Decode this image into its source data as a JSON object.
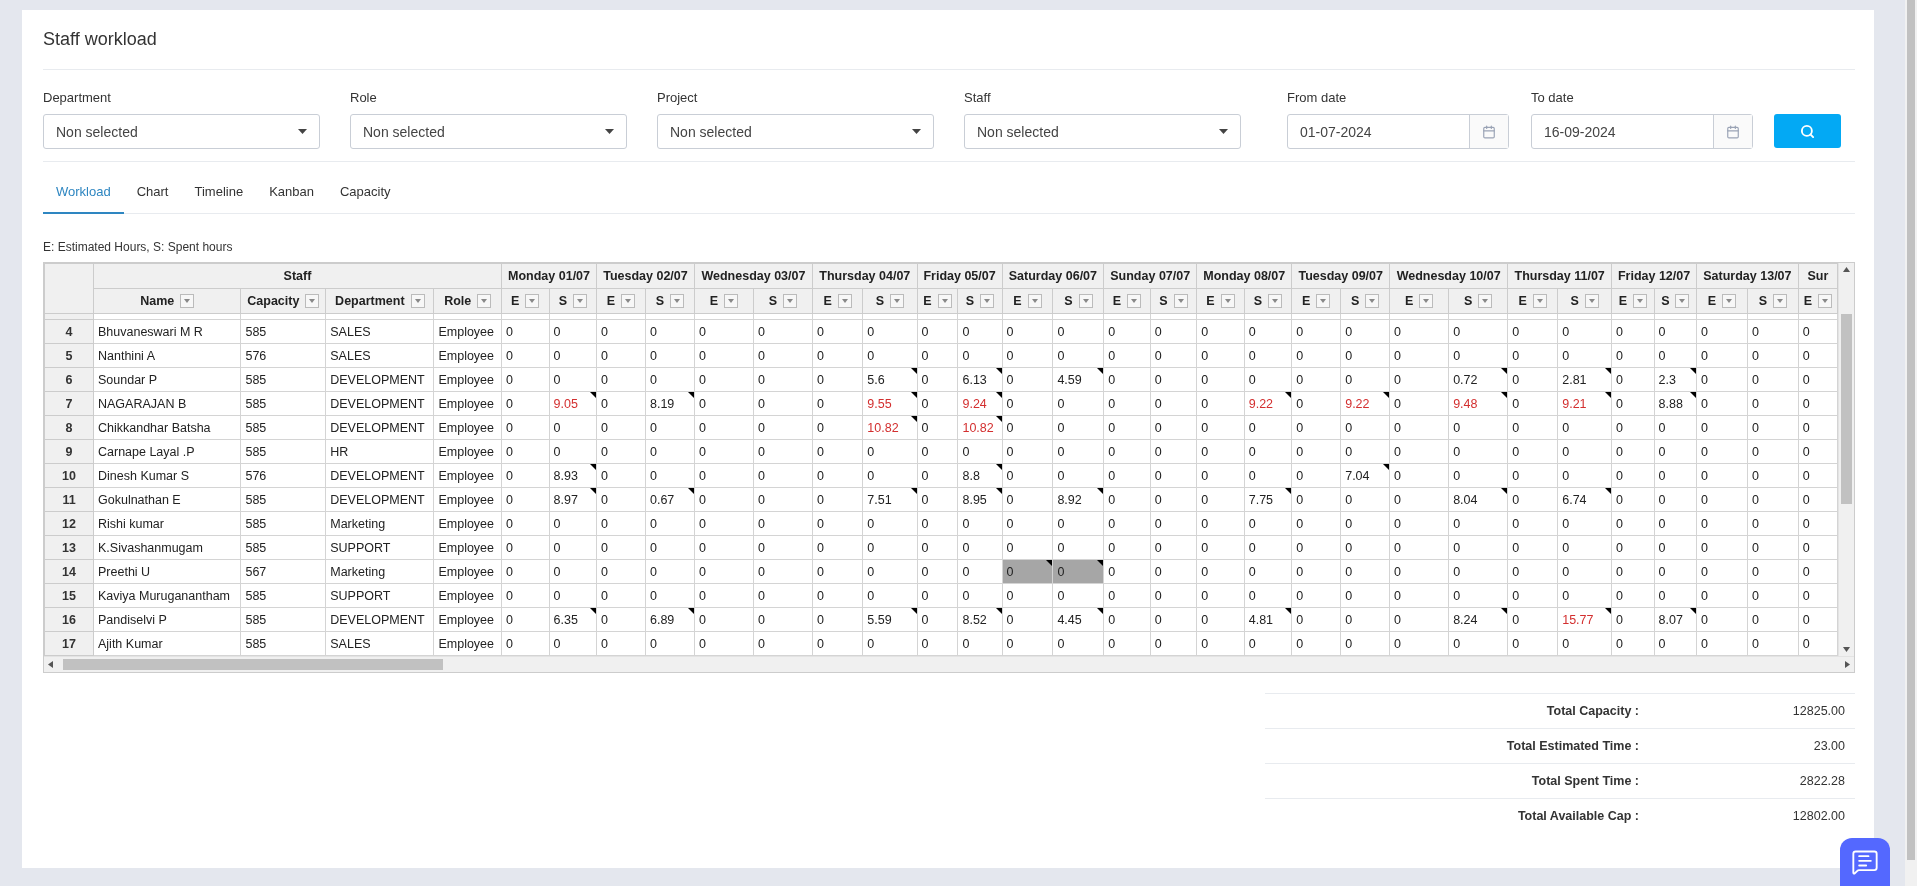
{
  "page": {
    "title": "Staff workload"
  },
  "filters": [
    {
      "kind": "select",
      "label": "Department",
      "value": "Non selected"
    },
    {
      "kind": "select",
      "label": "Role",
      "value": "Non selected"
    },
    {
      "kind": "select",
      "label": "Project",
      "value": "Non selected"
    },
    {
      "kind": "select",
      "label": "Staff",
      "value": "Non selected"
    },
    {
      "kind": "date",
      "label": "From date",
      "value": "01-07-2024"
    },
    {
      "kind": "date",
      "label": "To date",
      "value": "16-09-2024"
    }
  ],
  "tabs": [
    {
      "label": "Workload",
      "selected": true
    },
    {
      "label": "Chart",
      "selected": false
    },
    {
      "label": "Timeline",
      "selected": false
    },
    {
      "label": "Kanban",
      "selected": false
    },
    {
      "label": "Capacity",
      "selected": false
    }
  ],
  "legend": "E: Estimated Hours, S: Spent hours",
  "grid": {
    "group_label": "Staff",
    "staff_columns": [
      "Name",
      "Capacity",
      "Department",
      "Role"
    ],
    "days": [
      {
        "label": "Monday 01/07",
        "columns": [
          "E",
          "S"
        ]
      },
      {
        "label": "Tuesday 02/07",
        "columns": [
          "E",
          "S"
        ]
      },
      {
        "label": "Wednesday 03/07",
        "columns": [
          "E",
          "S"
        ]
      },
      {
        "label": "Thursday 04/07",
        "columns": [
          "E",
          "S"
        ]
      },
      {
        "label": "Friday 05/07",
        "columns": [
          "E",
          "S"
        ]
      },
      {
        "label": "Saturday 06/07",
        "columns": [
          "E",
          "S"
        ]
      },
      {
        "label": "Sunday 07/07",
        "columns": [
          "E",
          "S"
        ]
      },
      {
        "label": "Monday 08/07",
        "columns": [
          "E",
          "S"
        ]
      },
      {
        "label": "Tuesday 09/07",
        "columns": [
          "E",
          "S"
        ]
      },
      {
        "label": "Wednesday 10/07",
        "columns": [
          "E",
          "S"
        ]
      },
      {
        "label": "Thursday 11/07",
        "columns": [
          "E",
          "S"
        ]
      },
      {
        "label": "Friday 12/07",
        "columns": [
          "E",
          "S"
        ]
      },
      {
        "label": "Saturday 13/07",
        "columns": [
          "E",
          "S"
        ]
      },
      {
        "label": "Sur",
        "columns": [
          "E"
        ]
      }
    ],
    "rows": [
      {
        "index": "4",
        "name": "Bhuvaneswari M R",
        "capacity": "585",
        "department": "SALES",
        "role": "Employee",
        "cells": [
          "0",
          "0",
          "0",
          "0",
          "0",
          "0",
          "0",
          "0",
          "0",
          "0",
          "0",
          "0",
          "0",
          "0",
          "0",
          "0",
          "0",
          "0",
          "0",
          "0",
          "0",
          "0",
          "0",
          "0",
          "0",
          "0",
          "0"
        ],
        "notes": [
          false,
          false,
          false,
          false,
          false,
          false,
          false,
          false,
          false,
          false,
          false,
          false,
          false,
          false,
          false,
          false,
          false,
          false,
          false,
          false,
          false,
          false,
          false,
          false,
          false,
          false,
          false
        ],
        "over": [
          false,
          false,
          false,
          false,
          false,
          false,
          false,
          false,
          false,
          false,
          false,
          false,
          false,
          false,
          false,
          false,
          false,
          false,
          false,
          false,
          false,
          false,
          false,
          false,
          false,
          false,
          false
        ],
        "shaded": [
          false,
          false,
          false,
          false,
          false,
          false,
          false,
          false,
          false,
          false,
          false,
          false,
          false,
          false,
          false,
          false,
          false,
          false,
          false,
          false,
          false,
          false,
          false,
          false,
          false,
          false,
          false
        ]
      },
      {
        "index": "5",
        "name": "Nanthini A",
        "capacity": "576",
        "department": "SALES",
        "role": "Employee",
        "cells": [
          "0",
          "0",
          "0",
          "0",
          "0",
          "0",
          "0",
          "0",
          "0",
          "0",
          "0",
          "0",
          "0",
          "0",
          "0",
          "0",
          "0",
          "0",
          "0",
          "0",
          "0",
          "0",
          "0",
          "0",
          "0",
          "0",
          "0"
        ],
        "notes": [
          false,
          false,
          false,
          false,
          false,
          false,
          false,
          false,
          false,
          false,
          false,
          false,
          false,
          false,
          false,
          false,
          false,
          false,
          false,
          false,
          false,
          false,
          false,
          false,
          false,
          false,
          false
        ],
        "over": [
          false,
          false,
          false,
          false,
          false,
          false,
          false,
          false,
          false,
          false,
          false,
          false,
          false,
          false,
          false,
          false,
          false,
          false,
          false,
          false,
          false,
          false,
          false,
          false,
          false,
          false,
          false
        ],
        "shaded": [
          false,
          false,
          false,
          false,
          false,
          false,
          false,
          false,
          false,
          false,
          false,
          false,
          false,
          false,
          false,
          false,
          false,
          false,
          false,
          false,
          false,
          false,
          false,
          false,
          false,
          false,
          false
        ]
      },
      {
        "index": "6",
        "name": "Soundar P",
        "capacity": "585",
        "department": "DEVELOPMENT",
        "role": "Employee",
        "cells": [
          "0",
          "0",
          "0",
          "0",
          "0",
          "0",
          "0",
          "5.6",
          "0",
          "6.13",
          "0",
          "4.59",
          "0",
          "0",
          "0",
          "0",
          "0",
          "0",
          "0",
          "0.72",
          "0",
          "2.81",
          "0",
          "2.3",
          "0",
          "0",
          "0"
        ],
        "notes": [
          false,
          false,
          false,
          false,
          false,
          false,
          false,
          true,
          false,
          true,
          false,
          true,
          false,
          false,
          false,
          false,
          false,
          false,
          false,
          true,
          false,
          true,
          false,
          true,
          false,
          false,
          false
        ],
        "over": [
          false,
          false,
          false,
          false,
          false,
          false,
          false,
          false,
          false,
          false,
          false,
          false,
          false,
          false,
          false,
          false,
          false,
          false,
          false,
          false,
          false,
          false,
          false,
          false,
          false,
          false,
          false
        ],
        "shaded": [
          false,
          false,
          false,
          false,
          false,
          false,
          false,
          false,
          false,
          false,
          false,
          false,
          false,
          false,
          false,
          false,
          false,
          false,
          false,
          false,
          false,
          false,
          false,
          false,
          false,
          false,
          false
        ]
      },
      {
        "index": "7",
        "name": "NAGARAJAN B",
        "capacity": "585",
        "department": "DEVELOPMENT",
        "role": "Employee",
        "cells": [
          "0",
          "9.05",
          "0",
          "8.19",
          "0",
          "0",
          "0",
          "9.55",
          "0",
          "9.24",
          "0",
          "0",
          "0",
          "0",
          "0",
          "9.22",
          "0",
          "9.22",
          "0",
          "9.48",
          "0",
          "9.21",
          "0",
          "8.88",
          "0",
          "0",
          "0"
        ],
        "notes": [
          false,
          true,
          false,
          true,
          false,
          false,
          false,
          true,
          false,
          true,
          false,
          false,
          false,
          false,
          false,
          true,
          false,
          true,
          false,
          true,
          false,
          true,
          false,
          true,
          false,
          false,
          false
        ],
        "over": [
          false,
          true,
          false,
          false,
          false,
          false,
          false,
          true,
          false,
          true,
          false,
          false,
          false,
          false,
          false,
          true,
          false,
          true,
          false,
          true,
          false,
          true,
          false,
          false,
          false,
          false,
          false
        ],
        "shaded": [
          false,
          false,
          false,
          false,
          false,
          false,
          false,
          false,
          false,
          false,
          false,
          false,
          false,
          false,
          false,
          false,
          false,
          false,
          false,
          false,
          false,
          false,
          false,
          false,
          false,
          false,
          false
        ]
      },
      {
        "index": "8",
        "name": "Chikkandhar Batsha",
        "capacity": "585",
        "department": "DEVELOPMENT",
        "role": "Employee",
        "cells": [
          "0",
          "0",
          "0",
          "0",
          "0",
          "0",
          "0",
          "10.82",
          "0",
          "10.82",
          "0",
          "0",
          "0",
          "0",
          "0",
          "0",
          "0",
          "0",
          "0",
          "0",
          "0",
          "0",
          "0",
          "0",
          "0",
          "0",
          "0"
        ],
        "notes": [
          false,
          false,
          false,
          false,
          false,
          false,
          false,
          true,
          false,
          true,
          false,
          false,
          false,
          false,
          false,
          false,
          false,
          false,
          false,
          false,
          false,
          false,
          false,
          false,
          false,
          false,
          false
        ],
        "over": [
          false,
          false,
          false,
          false,
          false,
          false,
          false,
          true,
          false,
          true,
          false,
          false,
          false,
          false,
          false,
          false,
          false,
          false,
          false,
          false,
          false,
          false,
          false,
          false,
          false,
          false,
          false
        ],
        "shaded": [
          false,
          false,
          false,
          false,
          false,
          false,
          false,
          false,
          false,
          false,
          false,
          false,
          false,
          false,
          false,
          false,
          false,
          false,
          false,
          false,
          false,
          false,
          false,
          false,
          false,
          false,
          false
        ]
      },
      {
        "index": "9",
        "name": "Carnape Layal .P",
        "capacity": "585",
        "department": "HR",
        "role": "Employee",
        "cells": [
          "0",
          "0",
          "0",
          "0",
          "0",
          "0",
          "0",
          "0",
          "0",
          "0",
          "0",
          "0",
          "0",
          "0",
          "0",
          "0",
          "0",
          "0",
          "0",
          "0",
          "0",
          "0",
          "0",
          "0",
          "0",
          "0",
          "0"
        ],
        "notes": [
          false,
          false,
          false,
          false,
          false,
          false,
          false,
          false,
          false,
          false,
          false,
          false,
          false,
          false,
          false,
          false,
          false,
          false,
          false,
          false,
          false,
          false,
          false,
          false,
          false,
          false,
          false
        ],
        "over": [
          false,
          false,
          false,
          false,
          false,
          false,
          false,
          false,
          false,
          false,
          false,
          false,
          false,
          false,
          false,
          false,
          false,
          false,
          false,
          false,
          false,
          false,
          false,
          false,
          false,
          false,
          false
        ],
        "shaded": [
          false,
          false,
          false,
          false,
          false,
          false,
          false,
          false,
          false,
          false,
          false,
          false,
          false,
          false,
          false,
          false,
          false,
          false,
          false,
          false,
          false,
          false,
          false,
          false,
          false,
          false,
          false
        ]
      },
      {
        "index": "10",
        "name": "Dinesh Kumar S",
        "capacity": "576",
        "department": "DEVELOPMENT",
        "role": "Employee",
        "cells": [
          "0",
          "8.93",
          "0",
          "0",
          "0",
          "0",
          "0",
          "0",
          "0",
          "8.8",
          "0",
          "0",
          "0",
          "0",
          "0",
          "0",
          "0",
          "7.04",
          "0",
          "0",
          "0",
          "0",
          "0",
          "0",
          "0",
          "0",
          "0"
        ],
        "notes": [
          false,
          true,
          false,
          false,
          false,
          false,
          false,
          false,
          false,
          true,
          false,
          false,
          false,
          false,
          false,
          false,
          false,
          true,
          false,
          false,
          false,
          false,
          false,
          false,
          false,
          false,
          false
        ],
        "over": [
          false,
          false,
          false,
          false,
          false,
          false,
          false,
          false,
          false,
          false,
          false,
          false,
          false,
          false,
          false,
          false,
          false,
          false,
          false,
          false,
          false,
          false,
          false,
          false,
          false,
          false,
          false
        ],
        "shaded": [
          false,
          false,
          false,
          false,
          false,
          false,
          false,
          false,
          false,
          false,
          false,
          false,
          false,
          false,
          false,
          false,
          false,
          false,
          false,
          false,
          false,
          false,
          false,
          false,
          false,
          false,
          false
        ]
      },
      {
        "index": "11",
        "name": "Gokulnathan E",
        "capacity": "585",
        "department": "DEVELOPMENT",
        "role": "Employee",
        "cells": [
          "0",
          "8.97",
          "0",
          "0.67",
          "0",
          "0",
          "0",
          "7.51",
          "0",
          "8.95",
          "0",
          "8.92",
          "0",
          "0",
          "0",
          "7.75",
          "0",
          "0",
          "0",
          "8.04",
          "0",
          "6.74",
          "0",
          "0",
          "0",
          "0",
          "0"
        ],
        "notes": [
          false,
          true,
          false,
          true,
          false,
          false,
          false,
          true,
          false,
          true,
          false,
          true,
          false,
          false,
          false,
          true,
          false,
          false,
          false,
          true,
          false,
          true,
          false,
          false,
          false,
          false,
          false
        ],
        "over": [
          false,
          false,
          false,
          false,
          false,
          false,
          false,
          false,
          false,
          false,
          false,
          false,
          false,
          false,
          false,
          false,
          false,
          false,
          false,
          false,
          false,
          false,
          false,
          false,
          false,
          false,
          false
        ],
        "shaded": [
          false,
          false,
          false,
          false,
          false,
          false,
          false,
          false,
          false,
          false,
          false,
          false,
          false,
          false,
          false,
          false,
          false,
          false,
          false,
          false,
          false,
          false,
          false,
          false,
          false,
          false,
          false
        ]
      },
      {
        "index": "12",
        "name": "Rishi kumar",
        "capacity": "585",
        "department": "Marketing",
        "role": "Employee",
        "cells": [
          "0",
          "0",
          "0",
          "0",
          "0",
          "0",
          "0",
          "0",
          "0",
          "0",
          "0",
          "0",
          "0",
          "0",
          "0",
          "0",
          "0",
          "0",
          "0",
          "0",
          "0",
          "0",
          "0",
          "0",
          "0",
          "0",
          "0"
        ],
        "notes": [
          false,
          false,
          false,
          false,
          false,
          false,
          false,
          false,
          false,
          false,
          false,
          false,
          false,
          false,
          false,
          false,
          false,
          false,
          false,
          false,
          false,
          false,
          false,
          false,
          false,
          false,
          false
        ],
        "over": [
          false,
          false,
          false,
          false,
          false,
          false,
          false,
          false,
          false,
          false,
          false,
          false,
          false,
          false,
          false,
          false,
          false,
          false,
          false,
          false,
          false,
          false,
          false,
          false,
          false,
          false,
          false
        ],
        "shaded": [
          false,
          false,
          false,
          false,
          false,
          false,
          false,
          false,
          false,
          false,
          false,
          false,
          false,
          false,
          false,
          false,
          false,
          false,
          false,
          false,
          false,
          false,
          false,
          false,
          false,
          false,
          false
        ]
      },
      {
        "index": "13",
        "name": "K.Sivashanmugam",
        "capacity": "585",
        "department": "SUPPORT",
        "role": "Employee",
        "cells": [
          "0",
          "0",
          "0",
          "0",
          "0",
          "0",
          "0",
          "0",
          "0",
          "0",
          "0",
          "0",
          "0",
          "0",
          "0",
          "0",
          "0",
          "0",
          "0",
          "0",
          "0",
          "0",
          "0",
          "0",
          "0",
          "0",
          "0"
        ],
        "notes": [
          false,
          false,
          false,
          false,
          false,
          false,
          false,
          false,
          false,
          false,
          false,
          false,
          false,
          false,
          false,
          false,
          false,
          false,
          false,
          false,
          false,
          false,
          false,
          false,
          false,
          false,
          false
        ],
        "over": [
          false,
          false,
          false,
          false,
          false,
          false,
          false,
          false,
          false,
          false,
          false,
          false,
          false,
          false,
          false,
          false,
          false,
          false,
          false,
          false,
          false,
          false,
          false,
          false,
          false,
          false,
          false
        ],
        "shaded": [
          false,
          false,
          false,
          false,
          false,
          false,
          false,
          false,
          false,
          false,
          false,
          false,
          false,
          false,
          false,
          false,
          false,
          false,
          false,
          false,
          false,
          false,
          false,
          false,
          false,
          false,
          false
        ]
      },
      {
        "index": "14",
        "name": "Preethi U",
        "capacity": "567",
        "department": "Marketing",
        "role": "Employee",
        "cells": [
          "0",
          "0",
          "0",
          "0",
          "0",
          "0",
          "0",
          "0",
          "0",
          "0",
          "0",
          "0",
          "0",
          "0",
          "0",
          "0",
          "0",
          "0",
          "0",
          "0",
          "0",
          "0",
          "0",
          "0",
          "0",
          "0",
          "0"
        ],
        "notes": [
          false,
          false,
          false,
          false,
          false,
          false,
          false,
          false,
          false,
          false,
          true,
          true,
          false,
          false,
          false,
          false,
          false,
          false,
          false,
          false,
          false,
          false,
          false,
          false,
          false,
          false,
          false
        ],
        "over": [
          false,
          false,
          false,
          false,
          false,
          false,
          false,
          false,
          false,
          false,
          false,
          false,
          false,
          false,
          false,
          false,
          false,
          false,
          false,
          false,
          false,
          false,
          false,
          false,
          false,
          false,
          false
        ],
        "shaded": [
          false,
          false,
          false,
          false,
          false,
          false,
          false,
          false,
          false,
          false,
          true,
          true,
          false,
          false,
          false,
          false,
          false,
          false,
          false,
          false,
          false,
          false,
          false,
          false,
          false,
          false,
          false
        ]
      },
      {
        "index": "15",
        "name": "Kaviya Muruganantham",
        "capacity": "585",
        "department": "SUPPORT",
        "role": "Employee",
        "cells": [
          "0",
          "0",
          "0",
          "0",
          "0",
          "0",
          "0",
          "0",
          "0",
          "0",
          "0",
          "0",
          "0",
          "0",
          "0",
          "0",
          "0",
          "0",
          "0",
          "0",
          "0",
          "0",
          "0",
          "0",
          "0",
          "0",
          "0"
        ],
        "notes": [
          false,
          false,
          false,
          false,
          false,
          false,
          false,
          false,
          false,
          false,
          false,
          false,
          false,
          false,
          false,
          false,
          false,
          false,
          false,
          false,
          false,
          false,
          false,
          false,
          false,
          false,
          false
        ],
        "over": [
          false,
          false,
          false,
          false,
          false,
          false,
          false,
          false,
          false,
          false,
          false,
          false,
          false,
          false,
          false,
          false,
          false,
          false,
          false,
          false,
          false,
          false,
          false,
          false,
          false,
          false,
          false
        ],
        "shaded": [
          false,
          false,
          false,
          false,
          false,
          false,
          false,
          false,
          false,
          false,
          false,
          false,
          false,
          false,
          false,
          false,
          false,
          false,
          false,
          false,
          false,
          false,
          false,
          false,
          false,
          false,
          false
        ]
      },
      {
        "index": "16",
        "name": "Pandiselvi P",
        "capacity": "585",
        "department": "DEVELOPMENT",
        "role": "Employee",
        "cells": [
          "0",
          "6.35",
          "0",
          "6.89",
          "0",
          "0",
          "0",
          "5.59",
          "0",
          "8.52",
          "0",
          "4.45",
          "0",
          "0",
          "0",
          "4.81",
          "0",
          "0",
          "0",
          "8.24",
          "0",
          "15.77",
          "0",
          "8.07",
          "0",
          "0",
          "0"
        ],
        "notes": [
          false,
          true,
          false,
          true,
          false,
          false,
          false,
          true,
          false,
          true,
          false,
          true,
          false,
          false,
          false,
          true,
          false,
          false,
          false,
          true,
          false,
          true,
          false,
          true,
          false,
          false,
          false
        ],
        "over": [
          false,
          false,
          false,
          false,
          false,
          false,
          false,
          false,
          false,
          false,
          false,
          false,
          false,
          false,
          false,
          false,
          false,
          false,
          false,
          false,
          false,
          true,
          false,
          false,
          false,
          false,
          false
        ],
        "shaded": [
          false,
          false,
          false,
          false,
          false,
          false,
          false,
          false,
          false,
          false,
          false,
          false,
          false,
          false,
          false,
          false,
          false,
          false,
          false,
          false,
          false,
          false,
          false,
          false,
          false,
          false,
          false
        ]
      },
      {
        "index": "17",
        "name": "Ajith Kumar",
        "capacity": "585",
        "department": "SALES",
        "role": "Employee",
        "cells": [
          "0",
          "0",
          "0",
          "0",
          "0",
          "0",
          "0",
          "0",
          "0",
          "0",
          "0",
          "0",
          "0",
          "0",
          "0",
          "0",
          "0",
          "0",
          "0",
          "0",
          "0",
          "0",
          "0",
          "0",
          "0",
          "0",
          "0"
        ],
        "notes": [
          false,
          false,
          false,
          false,
          false,
          false,
          false,
          false,
          false,
          false,
          false,
          false,
          false,
          false,
          false,
          false,
          false,
          false,
          false,
          false,
          false,
          false,
          false,
          false,
          false,
          false,
          false
        ],
        "over": [
          false,
          false,
          false,
          false,
          false,
          false,
          false,
          false,
          false,
          false,
          false,
          false,
          false,
          false,
          false,
          false,
          false,
          false,
          false,
          false,
          false,
          false,
          false,
          false,
          false,
          false,
          false
        ],
        "shaded": [
          false,
          false,
          false,
          false,
          false,
          false,
          false,
          false,
          false,
          false,
          false,
          false,
          false,
          false,
          false,
          false,
          false,
          false,
          false,
          false,
          false,
          false,
          false,
          false,
          false,
          false,
          false
        ]
      }
    ]
  },
  "totals": [
    {
      "label": "Total Capacity :",
      "value": "12825.00"
    },
    {
      "label": "Total Estimated Time :",
      "value": "23.00"
    },
    {
      "label": "Total Spent Time :",
      "value": "2822.28"
    },
    {
      "label": "Total Available Cap :",
      "value": "12802.00"
    }
  ]
}
